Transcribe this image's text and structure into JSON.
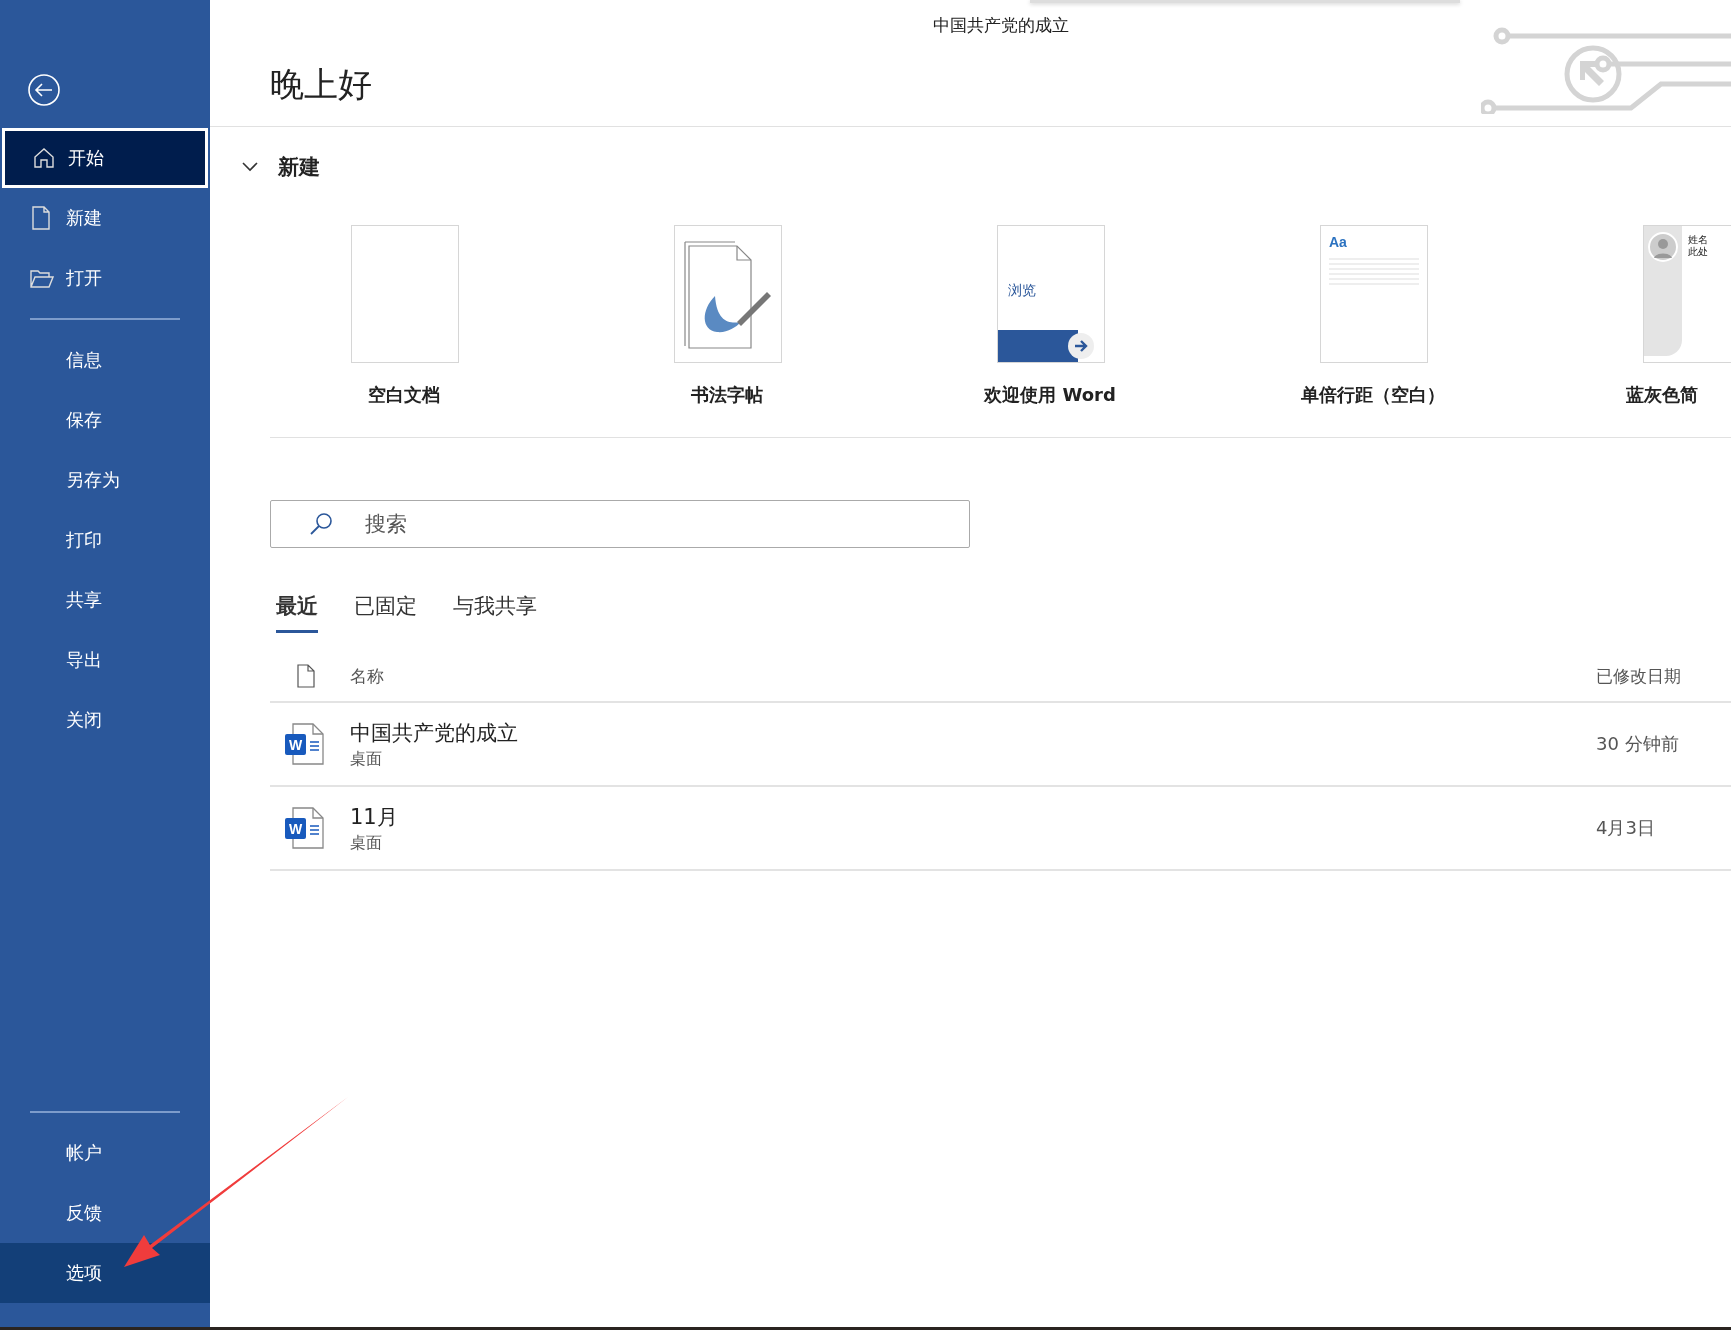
{
  "window": {
    "title": "中国共产党的成立"
  },
  "sidebar": {
    "items": [
      {
        "kind": "home",
        "label": "开始",
        "selected": true,
        "hover": false
      },
      {
        "kind": "page",
        "label": "新建",
        "selected": false,
        "hover": false
      },
      {
        "kind": "folder",
        "label": "打开",
        "selected": false,
        "hover": false
      },
      {
        "kind": "divider"
      },
      {
        "label": "信息",
        "selected": false,
        "hover": false
      },
      {
        "label": "保存",
        "selected": false,
        "hover": false
      },
      {
        "label": "另存为",
        "selected": false,
        "hover": false
      },
      {
        "label": "打印",
        "selected": false,
        "hover": false
      },
      {
        "label": "共享",
        "selected": false,
        "hover": false
      },
      {
        "label": "导出",
        "selected": false,
        "hover": false
      },
      {
        "label": "关闭",
        "selected": false,
        "hover": false
      },
      {
        "kind": "spacer"
      },
      {
        "kind": "divider"
      },
      {
        "label": "帐户",
        "selected": false,
        "hover": false
      },
      {
        "label": "反馈",
        "selected": false,
        "hover": false
      },
      {
        "label": "选项",
        "selected": false,
        "hover": true
      }
    ]
  },
  "greeting": "晚上好",
  "new_section": {
    "title": "新建",
    "expanded": true,
    "templates": [
      {
        "kind": "blank",
        "label": "空白文档"
      },
      {
        "kind": "calligraphy",
        "label": "书法字帖"
      },
      {
        "kind": "tour",
        "label": "欢迎使用 Word",
        "thumb_text": "浏览"
      },
      {
        "kind": "lines",
        "label": "单倍行距（空白）",
        "thumb_text": "Aa"
      },
      {
        "kind": "resume",
        "label": "蓝灰色简",
        "thumb_lines": [
          "姓名",
          "此处"
        ]
      }
    ]
  },
  "search": {
    "placeholder": "搜索"
  },
  "tabs": [
    {
      "label": "最近",
      "selected": true
    },
    {
      "label": "已固定",
      "selected": false
    },
    {
      "label": "与我共享",
      "selected": false
    }
  ],
  "table": {
    "columns": [
      "名称",
      "已修改日期"
    ],
    "rows": [
      {
        "icon_letter": "W",
        "name": "中国共产党的成立",
        "location": "桌面",
        "modified": "30 分钟前"
      },
      {
        "icon_letter": "W",
        "name": "11月",
        "location": "桌面",
        "modified": "4月3日"
      }
    ]
  }
}
